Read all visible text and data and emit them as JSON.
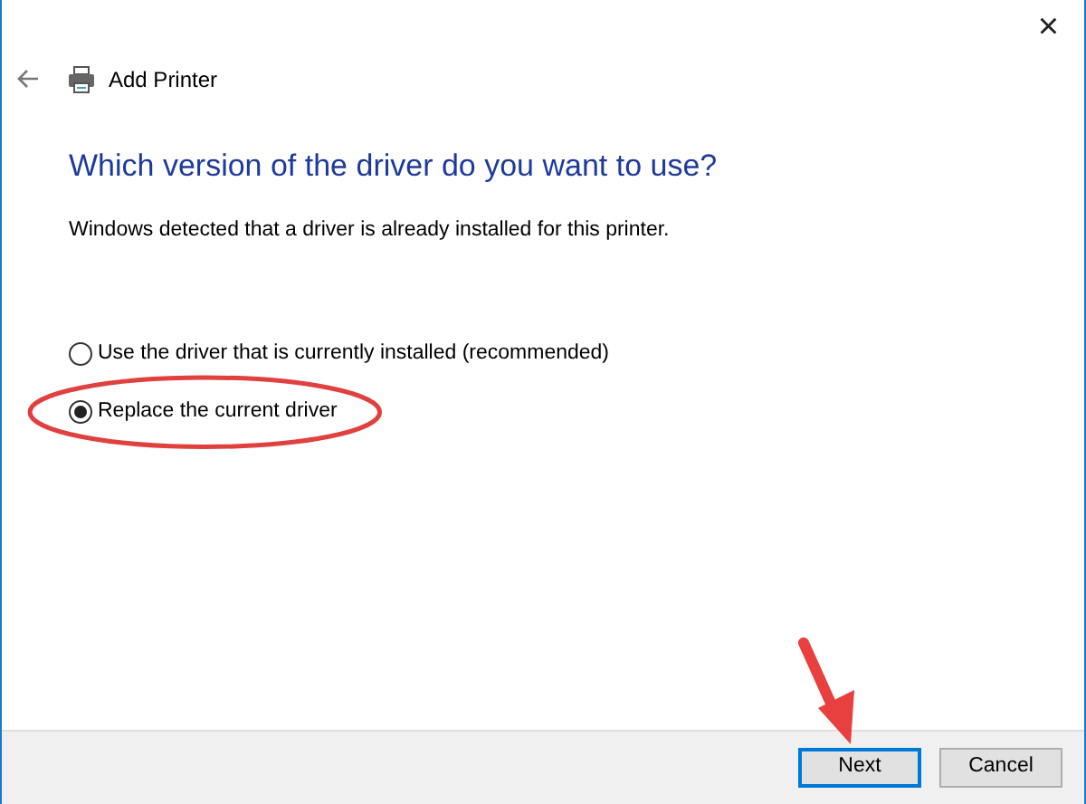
{
  "window": {
    "close_glyph": "×"
  },
  "header": {
    "title": "Add Printer"
  },
  "heading": "Which version of the driver do you want to use?",
  "description": "Windows detected that a driver is already installed for this printer.",
  "options": [
    {
      "label": "Use the driver that is currently installed (recommended)",
      "selected": false,
      "circled": false
    },
    {
      "label": "Replace the current driver",
      "selected": true,
      "circled": true
    }
  ],
  "buttons": [
    {
      "label": "Next",
      "kind": "default",
      "arrow_pointed": true
    },
    {
      "label": "Cancel",
      "kind": "normal",
      "arrow_pointed": false
    }
  ]
}
